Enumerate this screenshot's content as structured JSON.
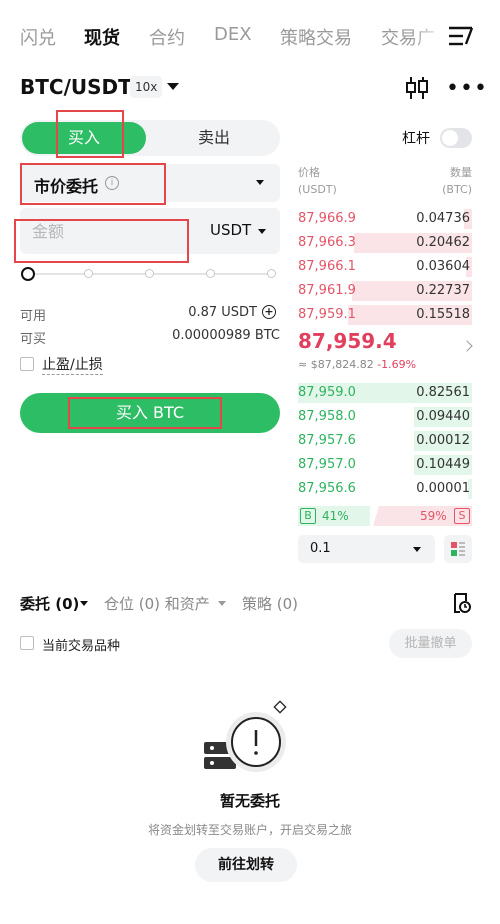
{
  "nav": {
    "tabs": [
      {
        "label": "闪兑"
      },
      {
        "label": "现货"
      },
      {
        "label": "合约"
      },
      {
        "label": "DEX"
      },
      {
        "label": "策略交易"
      },
      {
        "label": "交易广"
      }
    ],
    "menu_icon": "menu-lines-icon"
  },
  "pair": {
    "symbol": "BTC/USDT",
    "leverage": "10x",
    "chart_icon": "candlestick-icon",
    "more_icon": "more-icon"
  },
  "trade": {
    "buy_tab": "买入",
    "sell_tab": "卖出",
    "margin_label": "杠杆",
    "margin_enabled": false,
    "order_type": "市价委托",
    "amount_placeholder": "金额",
    "amount_unit": "USDT",
    "slider_percent": 0,
    "available_label": "可用",
    "available_value": "0.87 USDT",
    "buyable_label": "可买",
    "buyable_value": "0.00000989 BTC",
    "tpsl_label": "止盈/止损",
    "submit_label": "买入 BTC"
  },
  "orderbook": {
    "price_header": "价格",
    "price_unit": "(USDT)",
    "qty_header": "数量",
    "qty_unit": "(BTC)",
    "asks": [
      {
        "price": "87,966.9",
        "qty": "0.04736"
      },
      {
        "price": "87,966.3",
        "qty": "0.20462"
      },
      {
        "price": "87,966.1",
        "qty": "0.03604"
      },
      {
        "price": "87,961.9",
        "qty": "0.22737"
      },
      {
        "price": "87,959.1",
        "qty": "0.15518"
      }
    ],
    "last_price": "87,959.4",
    "last_usd": "≈ $87,824.82",
    "last_change": "-1.69%",
    "bids": [
      {
        "price": "87,959.0",
        "qty": "0.82561"
      },
      {
        "price": "87,958.0",
        "qty": "0.09440"
      },
      {
        "price": "87,957.6",
        "qty": "0.00012"
      },
      {
        "price": "87,957.0",
        "qty": "0.10449"
      },
      {
        "price": "87,956.6",
        "qty": "0.00001"
      }
    ],
    "buy_tag": "B",
    "buy_ratio": "41%",
    "sell_ratio": "59%",
    "sell_tag": "S",
    "depth_value": "0.1",
    "colors": {
      "ask": "#e45468",
      "bid": "#2eb35e"
    }
  },
  "orders": {
    "tab_orders": "委托 (0)",
    "tab_positions": "仓位 (0) 和资产",
    "tab_strategy": "策略 (0)",
    "current_pair_only": "当前交易品种",
    "batch_cancel": "批量撤单",
    "empty_title": "暂无委托",
    "empty_sub": "将资金划转至交易账户，开启交易之旅",
    "transfer_btn": "前往划转"
  },
  "colors": {
    "accent_green": "#2dbd64",
    "highlight_red": "#e4474a"
  }
}
